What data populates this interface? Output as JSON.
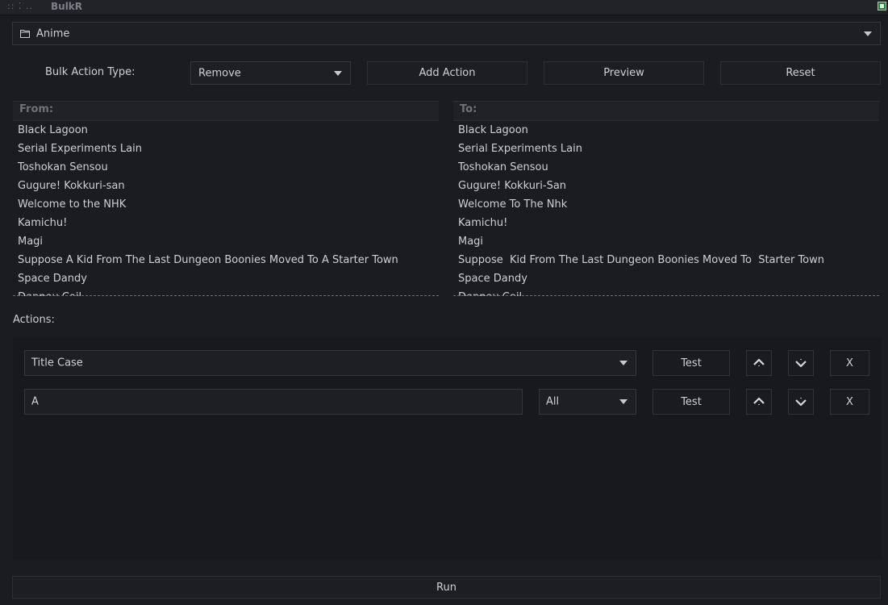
{
  "window": {
    "grips": ":: ⁚ ..",
    "title": "BulkR"
  },
  "library_select": {
    "value": "Anime",
    "icon": "folder-icon"
  },
  "bulk_action": {
    "label": "Bulk Action Type:",
    "type_value": "Remove",
    "add_action": "Add Action",
    "preview": "Preview",
    "reset": "Reset"
  },
  "from_list": {
    "header": "From:",
    "items": [
      "Black Lagoon",
      "Serial Experiments Lain",
      "Toshokan Sensou",
      "Gugure! Kokkuri-san",
      "Welcome to the NHK",
      "Kamichu!",
      "Magi",
      "Suppose A Kid From The Last Dungeon Boonies Moved To A Starter Town",
      "Space Dandy",
      "Dennou Coil"
    ]
  },
  "to_list": {
    "header": "To:",
    "items": [
      "Black Lagoon",
      "Serial Experiments Lain",
      "Toshokan Sensou",
      "Gugure! Kokkuri-San",
      "Welcome To The Nhk",
      "Kamichu!",
      "Magi",
      "Suppose  Kid From The Last Dungeon Boonies Moved To  Starter Town",
      "Space Dandy",
      "Dennou Coil"
    ]
  },
  "actions": {
    "label": "Actions:",
    "rows": [
      {
        "select_value": "Title Case",
        "test": "Test",
        "remove": "X"
      },
      {
        "input_value": "A",
        "scope_value": "All",
        "test": "Test",
        "remove": "X"
      }
    ]
  },
  "run": {
    "label": "Run"
  }
}
